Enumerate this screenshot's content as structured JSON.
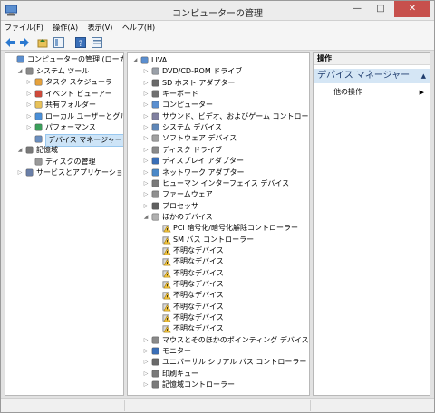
{
  "window": {
    "title": "コンピューターの管理"
  },
  "menu": [
    "ファイル(F)",
    "操作(A)",
    "表示(V)",
    "ヘルプ(H)"
  ],
  "toolbar_icons": [
    "back-arrow-icon",
    "forward-arrow-icon",
    "folder-up-icon",
    "show-hide-tree-icon",
    "help-icon",
    "properties-icon"
  ],
  "left_tree": [
    {
      "label": "コンピューターの管理 (ローカル)",
      "level": 0,
      "arrow": "",
      "icon": "computer-management-icon"
    },
    {
      "label": "システム ツール",
      "level": 1,
      "arrow": "◢",
      "icon": "tools-icon"
    },
    {
      "label": "タスク スケジューラ",
      "level": 2,
      "arrow": "▷",
      "icon": "clock-icon"
    },
    {
      "label": "イベント ビューアー",
      "level": 2,
      "arrow": "▷",
      "icon": "event-viewer-icon"
    },
    {
      "label": "共有フォルダー",
      "level": 2,
      "arrow": "▷",
      "icon": "shared-folder-icon"
    },
    {
      "label": "ローカル ユーザーとグループ",
      "level": 2,
      "arrow": "▷",
      "icon": "users-icon"
    },
    {
      "label": "パフォーマンス",
      "level": 2,
      "arrow": "▷",
      "icon": "performance-icon"
    },
    {
      "label": "デバイス マネージャー",
      "level": 2,
      "arrow": "",
      "icon": "device-manager-icon",
      "selected": true
    },
    {
      "label": "記憶域",
      "level": 1,
      "arrow": "◢",
      "icon": "storage-icon"
    },
    {
      "label": "ディスクの管理",
      "level": 2,
      "arrow": "",
      "icon": "disk-icon"
    },
    {
      "label": "サービスとアプリケーション",
      "level": 1,
      "arrow": "▷",
      "icon": "services-icon"
    }
  ],
  "device_tree": [
    {
      "label": "LIVA",
      "level": 0,
      "arrow": "◢",
      "icon": "computer-icon"
    },
    {
      "label": "DVD/CD-ROM ドライブ",
      "level": 1,
      "arrow": "▷",
      "icon": "dvd-icon"
    },
    {
      "label": "SD ホスト アダプター",
      "level": 1,
      "arrow": "▷",
      "icon": "sd-icon"
    },
    {
      "label": "キーボード",
      "level": 1,
      "arrow": "▷",
      "icon": "keyboard-icon"
    },
    {
      "label": "コンピューター",
      "level": 1,
      "arrow": "▷",
      "icon": "computer-icon"
    },
    {
      "label": "サウンド、ビデオ、およびゲーム コントローラー",
      "level": 1,
      "arrow": "▷",
      "icon": "speaker-icon"
    },
    {
      "label": "システム デバイス",
      "level": 1,
      "arrow": "▷",
      "icon": "system-device-icon"
    },
    {
      "label": "ソフトウェア デバイス",
      "level": 1,
      "arrow": "▷",
      "icon": "software-device-icon"
    },
    {
      "label": "ディスク ドライブ",
      "level": 1,
      "arrow": "▷",
      "icon": "disk-drive-icon"
    },
    {
      "label": "ディスプレイ アダプター",
      "level": 1,
      "arrow": "▷",
      "icon": "display-icon"
    },
    {
      "label": "ネットワーク アダプター",
      "level": 1,
      "arrow": "▷",
      "icon": "network-icon"
    },
    {
      "label": "ヒューマン インターフェイス デバイス",
      "level": 1,
      "arrow": "▷",
      "icon": "hid-icon"
    },
    {
      "label": "ファームウェア",
      "level": 1,
      "arrow": "▷",
      "icon": "firmware-icon"
    },
    {
      "label": "プロセッサ",
      "level": 1,
      "arrow": "▷",
      "icon": "processor-icon"
    },
    {
      "label": "ほかのデバイス",
      "level": 1,
      "arrow": "◢",
      "icon": "unknown-device-icon"
    },
    {
      "label": "PCI 暗号化/暗号化解除コントローラー",
      "level": 2,
      "arrow": "",
      "icon": "warning-icon"
    },
    {
      "label": "SM バス コントローラー",
      "level": 2,
      "arrow": "",
      "icon": "warning-icon"
    },
    {
      "label": "不明なデバイス",
      "level": 2,
      "arrow": "",
      "icon": "warning-icon"
    },
    {
      "label": "不明なデバイス",
      "level": 2,
      "arrow": "",
      "icon": "warning-icon"
    },
    {
      "label": "不明なデバイス",
      "level": 2,
      "arrow": "",
      "icon": "warning-icon"
    },
    {
      "label": "不明なデバイス",
      "level": 2,
      "arrow": "",
      "icon": "warning-icon"
    },
    {
      "label": "不明なデバイス",
      "level": 2,
      "arrow": "",
      "icon": "warning-icon"
    },
    {
      "label": "不明なデバイス",
      "level": 2,
      "arrow": "",
      "icon": "warning-icon"
    },
    {
      "label": "不明なデバイス",
      "level": 2,
      "arrow": "",
      "icon": "warning-icon"
    },
    {
      "label": "不明なデバイス",
      "level": 2,
      "arrow": "",
      "icon": "warning-icon"
    },
    {
      "label": "マウスとそのほかのポインティング デバイス",
      "level": 1,
      "arrow": "▷",
      "icon": "mouse-icon"
    },
    {
      "label": "モニター",
      "level": 1,
      "arrow": "▷",
      "icon": "monitor-icon"
    },
    {
      "label": "ユニバーサル シリアル バス コントローラー",
      "level": 1,
      "arrow": "▷",
      "icon": "usb-icon"
    },
    {
      "label": "印刷キュー",
      "level": 1,
      "arrow": "▷",
      "icon": "printer-icon"
    },
    {
      "label": "記憶域コントローラー",
      "level": 1,
      "arrow": "▷",
      "icon": "storage-controller-icon"
    }
  ],
  "ops": {
    "header": "操作",
    "section": "デバイス マネージャー",
    "item": "他の操作",
    "item_arrow": "▶",
    "section_caret": "▲"
  },
  "colors": {
    "selection": "#cde4f7",
    "warning": "#f2c43b",
    "close": "#c7504c"
  }
}
